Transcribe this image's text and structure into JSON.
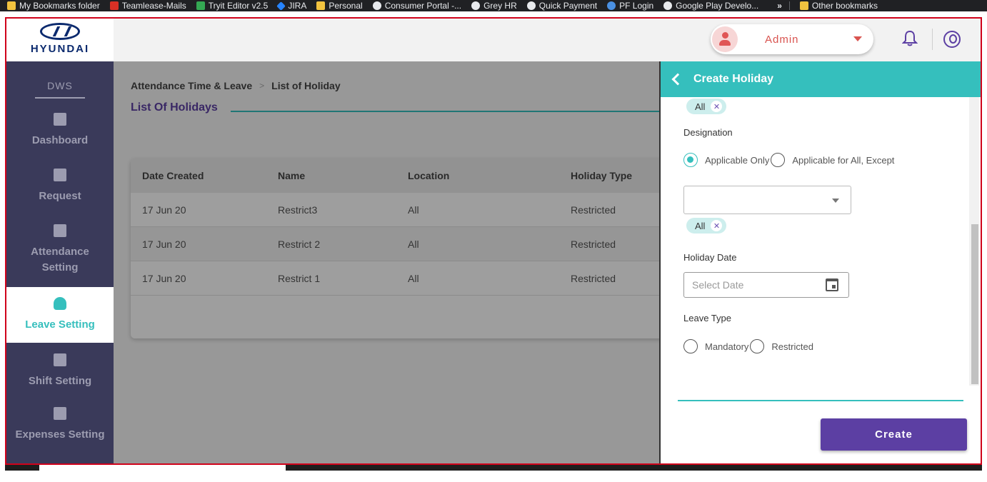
{
  "bookmarks": [
    {
      "label": "My Bookmarks folder",
      "icon": "folder-icon"
    },
    {
      "label": "Teamlease-Mails",
      "icon": "gmail-icon"
    },
    {
      "label": "Tryit Editor v2.5",
      "icon": "w3-icon"
    },
    {
      "label": "JIRA",
      "icon": "jira-icon"
    },
    {
      "label": "Personal",
      "icon": "folder-icon"
    },
    {
      "label": "Consumer Portal -...",
      "icon": "globe-icon"
    },
    {
      "label": "Grey HR",
      "icon": "globe-icon"
    },
    {
      "label": "Quick Payment",
      "icon": "globe-icon"
    },
    {
      "label": "PF Login",
      "icon": "pf-icon"
    },
    {
      "label": "Google Play Develo...",
      "icon": "globe-icon"
    }
  ],
  "bookmarks_more": "»",
  "other_bookmarks": "Other bookmarks",
  "brand": {
    "logo_text": "HYUNDAI"
  },
  "header": {
    "user_role": "Admin",
    "accent_color": "#35bfbd",
    "primary_color": "#5c3fa3"
  },
  "sidebar": {
    "section_title": "DWS",
    "items": [
      {
        "label": "Dashboard",
        "icon": "dashboard-icon",
        "active": false
      },
      {
        "label": "Request",
        "icon": "request-icon",
        "active": false
      },
      {
        "label": "Attendance Setting",
        "icon": "attendance-icon",
        "active": false
      },
      {
        "label": "Leave Setting",
        "icon": "beach-umbrella-icon",
        "active": true
      },
      {
        "label": "Shift Setting",
        "icon": "document-icon",
        "active": false
      },
      {
        "label": "Expenses Setting",
        "icon": "document-icon",
        "active": false
      }
    ]
  },
  "main": {
    "breadcrumb": [
      "Attendance Time & Leave",
      "List of Holiday"
    ],
    "breadcrumb_sep": ">",
    "page_title": "List Of Holidays",
    "table": {
      "columns": [
        "Date Created",
        "Name",
        "Location",
        "Holiday Type"
      ],
      "rows": [
        [
          "17 Jun 20",
          "Restrict3",
          "All",
          "Restricted"
        ],
        [
          "17 Jun 20",
          "Restrict 2",
          "All",
          "Restricted"
        ],
        [
          "17 Jun 20",
          "Restrict 1",
          "All",
          "Restricted"
        ]
      ]
    }
  },
  "drawer": {
    "title": "Create Holiday",
    "location_chip": "All",
    "designation_label": "Designation",
    "designation_options": [
      "Applicable Only",
      "Applicable for All, Except"
    ],
    "designation_selected": "Applicable Only",
    "designation_chip": "All",
    "holiday_date_label": "Holiday Date",
    "holiday_date_placeholder": "Select Date",
    "leave_type_label": "Leave Type",
    "leave_type_options": [
      "Mandatory",
      "Restricted"
    ],
    "create_button": "Create"
  }
}
